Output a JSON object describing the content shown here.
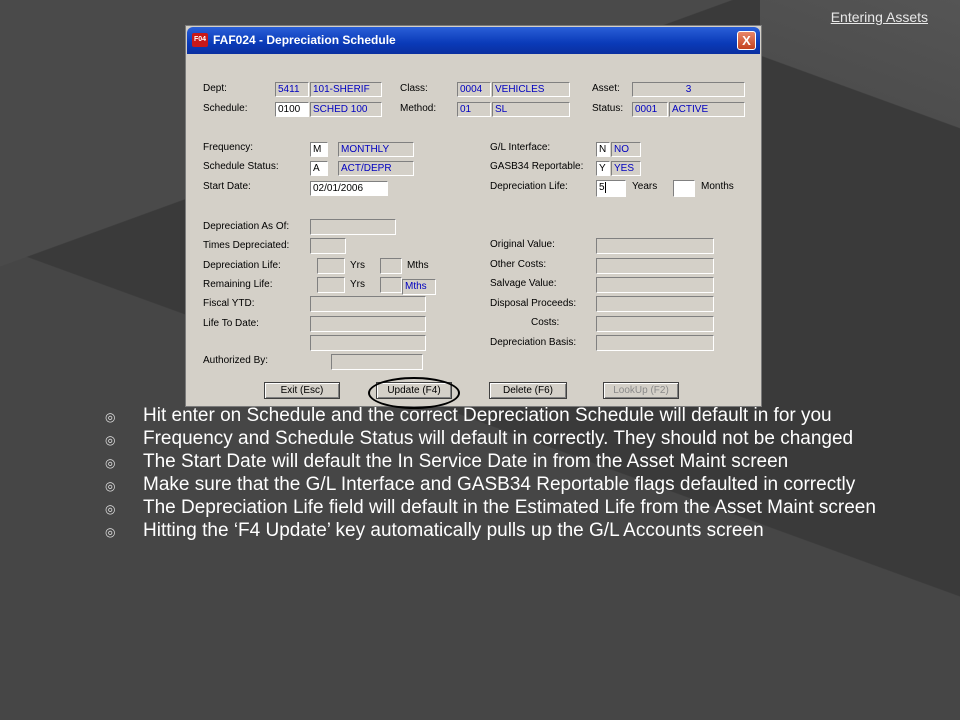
{
  "header": {
    "link": "Entering Assets"
  },
  "window": {
    "icon_text": "F04",
    "title": "FAF024 - Depreciation Schedule",
    "close": "X"
  },
  "form": {
    "dept": {
      "label": "Dept:",
      "code": "5411",
      "name": "101-SHERIF"
    },
    "class": {
      "label": "Class:",
      "code": "0004",
      "name": "VEHICLES"
    },
    "asset": {
      "label": "Asset:",
      "value": "3"
    },
    "schedule": {
      "label": "Schedule:",
      "code": "0100",
      "name": "SCHED 100"
    },
    "method": {
      "label": "Method:",
      "code": "01",
      "name": "SL"
    },
    "status": {
      "label": "Status:",
      "code": "0001",
      "name": "ACTIVE"
    },
    "frequency": {
      "label": "Frequency:",
      "code": "M",
      "name": "MONTHLY"
    },
    "schedule_status": {
      "label": "Schedule Status:",
      "code": "A",
      "name": "ACT/DEPR"
    },
    "start_date": {
      "label": "Start Date:",
      "value": "02/01/2006"
    },
    "gl_interface": {
      "label": "G/L Interface:",
      "code": "N",
      "name": "NO"
    },
    "gasb34": {
      "label": "GASB34 Reportable:",
      "code": "Y",
      "name": "YES"
    },
    "dep_life_top": {
      "label": "Depreciation Life:",
      "years": "5",
      "years_label": "Years",
      "months_label": "Months"
    },
    "dep_as_of": {
      "label": "Depreciation As Of:"
    },
    "times_depreciated": {
      "label": "Times Depreciated:"
    },
    "dep_life": {
      "label": "Depreciation Life:",
      "yrs": "Yrs",
      "mths": "Mths"
    },
    "remaining_life": {
      "label": "Remaining Life:",
      "yrs": "Yrs",
      "mths": "Mths"
    },
    "fiscal_ytd": {
      "label": "Fiscal YTD:"
    },
    "life_to_date": {
      "label": "Life To Date:"
    },
    "authorized_by": {
      "label": "Authorized By:"
    },
    "original_value": {
      "label": "Original Value:"
    },
    "other_costs": {
      "label": "Other Costs:"
    },
    "salvage_value": {
      "label": "Salvage Value:"
    },
    "disposal_proceeds": {
      "label": "Disposal Proceeds:"
    },
    "costs": {
      "label": "Costs:"
    },
    "dep_basis": {
      "label": "Depreciation Basis:"
    }
  },
  "buttons": {
    "exit": "Exit (Esc)",
    "update": "Update (F4)",
    "delete": "Delete (F6)",
    "lookup": "LookUp (F2)"
  },
  "bullets": [
    "Hit enter on Schedule and the correct Depreciation Schedule will default in for you",
    "Frequency and Schedule Status will default in correctly.  They should not be changed",
    "The Start Date will default the In Service Date in from the Asset Maint screen",
    "Make sure that the G/L Interface and GASB34 Reportable flags defaulted in correctly",
    "The Depreciation Life field will default in the Estimated Life from the Asset Maint screen",
    "Hitting the ‘F4 Update’ key automatically pulls up the G/L Accounts screen"
  ]
}
